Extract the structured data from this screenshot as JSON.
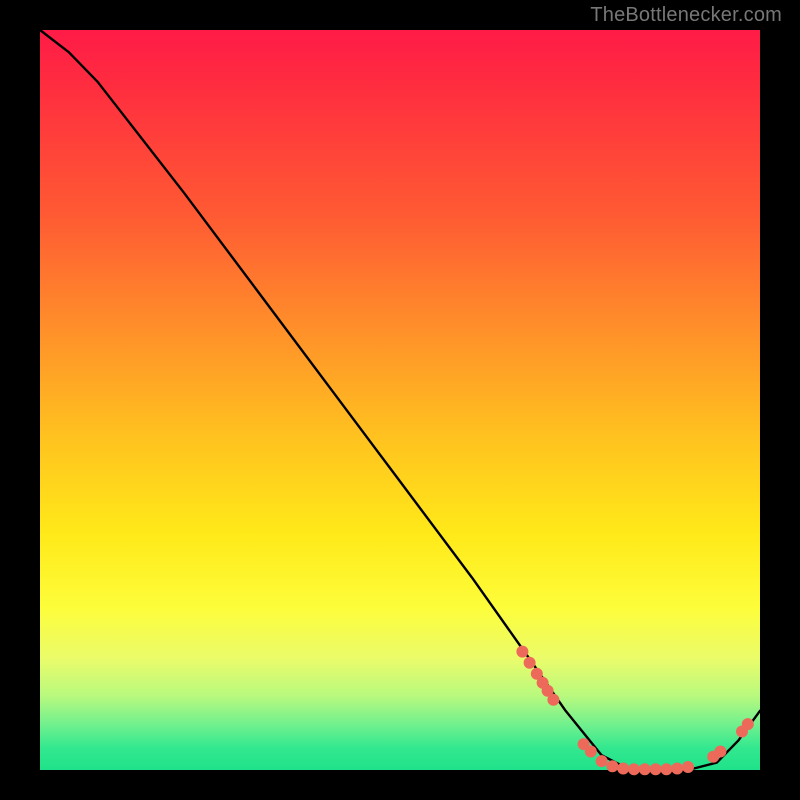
{
  "attribution": "TheBottlenecker.com",
  "chart_data": {
    "type": "line",
    "title": "",
    "xlabel": "",
    "ylabel": "",
    "x_range": [
      0,
      100
    ],
    "y_range": [
      0,
      100
    ],
    "series": [
      {
        "name": "bottleneck-curve",
        "x": [
          0,
          4,
          8,
          12,
          20,
          30,
          40,
          50,
          60,
          68,
          73,
          78,
          82,
          86,
          90,
          94,
          97,
          100
        ],
        "y": [
          100,
          97,
          93,
          88,
          78,
          65,
          52,
          39,
          26,
          15,
          8,
          2,
          0,
          0,
          0,
          1,
          4,
          8
        ]
      }
    ],
    "markers": {
      "name": "sample-points",
      "points": [
        {
          "x": 67,
          "y": 16
        },
        {
          "x": 68,
          "y": 14.5
        },
        {
          "x": 69,
          "y": 13
        },
        {
          "x": 69.8,
          "y": 11.8
        },
        {
          "x": 70.5,
          "y": 10.7
        },
        {
          "x": 71.3,
          "y": 9.5
        },
        {
          "x": 75.5,
          "y": 3.5
        },
        {
          "x": 76.5,
          "y": 2.5
        },
        {
          "x": 78,
          "y": 1.2
        },
        {
          "x": 79.5,
          "y": 0.5
        },
        {
          "x": 81,
          "y": 0.2
        },
        {
          "x": 82.5,
          "y": 0.1
        },
        {
          "x": 84,
          "y": 0.1
        },
        {
          "x": 85.5,
          "y": 0.1
        },
        {
          "x": 87,
          "y": 0.1
        },
        {
          "x": 88.5,
          "y": 0.2
        },
        {
          "x": 90,
          "y": 0.4
        },
        {
          "x": 93.5,
          "y": 1.8
        },
        {
          "x": 94.5,
          "y": 2.5
        },
        {
          "x": 97.5,
          "y": 5.2
        },
        {
          "x": 98.3,
          "y": 6.2
        }
      ]
    },
    "colors": {
      "curve": "#000000",
      "marker": "#ed6a5a",
      "gradient_top": "#ff1b47",
      "gradient_bottom": "#1fe28a"
    }
  }
}
